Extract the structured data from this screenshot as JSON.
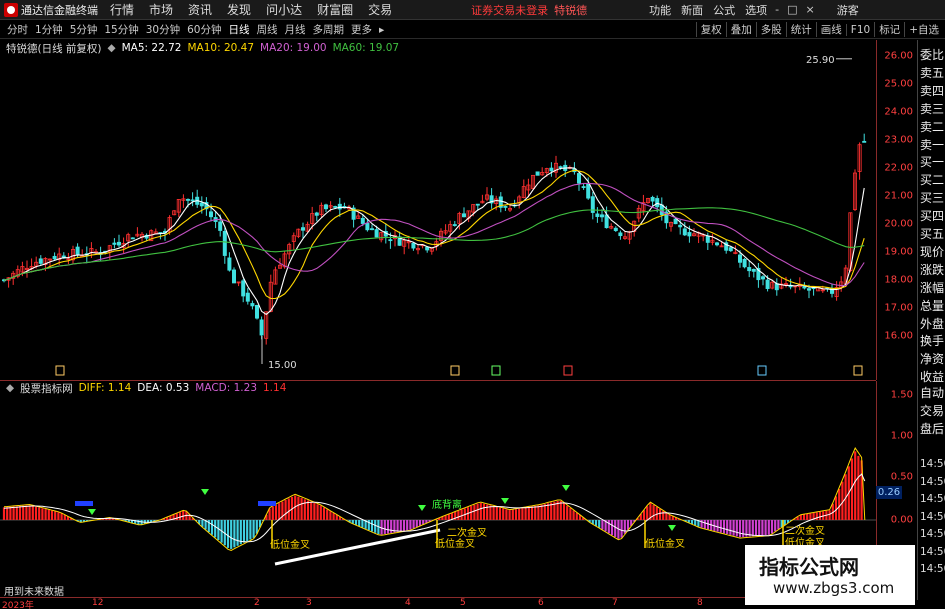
{
  "app": {
    "title": "通达信金融终端"
  },
  "menu": [
    "行情",
    "市场",
    "资讯",
    "发现",
    "问小达",
    "财富圈",
    "交易"
  ],
  "status": {
    "login": "证券交易未登录",
    "stock_name": "特锐德"
  },
  "right_menu": [
    "功能",
    "新面",
    "公式",
    "选项"
  ],
  "guest_label": "游客",
  "window_controls": [
    "-",
    "□",
    "×"
  ],
  "periods": [
    "分时",
    "1分钟",
    "5分钟",
    "15分钟",
    "30分钟",
    "60分钟",
    "日线",
    "周线",
    "月线",
    "多周期",
    "更多"
  ],
  "active_period": "日线",
  "toolbar_right": [
    "复权",
    "叠加",
    "多股",
    "统计",
    "画线",
    "F10",
    "标记",
    "+自选"
  ],
  "chart_header": {
    "stock": "特锐德(日线 前复权)",
    "ma5": "MA5: 22.72",
    "ma10": "MA10: 20.47",
    "ma20": "MA20: 19.00",
    "ma60": "MA60: 19.07"
  },
  "colors": {
    "ma5": "#ffffff",
    "ma10": "#ffd700",
    "ma20": "#c050c0",
    "ma60": "#40c040",
    "up": "#ff3030",
    "down": "#40e0e0",
    "axis": "#ff4040"
  },
  "price_axis": [
    "26.00",
    "25.00",
    "24.00",
    "23.00",
    "22.00",
    "21.00",
    "20.00",
    "19.00",
    "18.00",
    "17.00",
    "16.00"
  ],
  "price_annotations": {
    "high": "25.90",
    "low": "15.00"
  },
  "macd_header": {
    "name": "股票指标网",
    "diff": "DIFF: 1.14",
    "dea": "DEA: 0.53",
    "macd": "MACD: 1.23",
    "extra": "1.14"
  },
  "macd_axis": [
    "1.50",
    "1.00",
    "0.50",
    "0.00"
  ],
  "macd_current": "0.26",
  "macd_labels": [
    "低位金叉",
    "底背离",
    "二次金叉",
    "低位金叉",
    "低位金叉",
    "二次金叉",
    "低位金叉"
  ],
  "side_panel": [
    "委比",
    "卖五",
    "卖四",
    "卖三",
    "卖二",
    "卖一",
    "买一",
    "买二",
    "买三",
    "买四",
    "买五",
    "现价",
    "涨跌",
    "涨幅",
    "总量",
    "外盘",
    "换手",
    "净资",
    "收益",
    "自动",
    "交易",
    "盘后",
    "14:50",
    "14:50",
    "14:50",
    "14:50",
    "14:50",
    "14:50",
    "14:50"
  ],
  "date_axis": [
    "2023年",
    "12",
    "2",
    "3",
    "4",
    "5",
    "6",
    "7",
    "8"
  ],
  "hint": "用到未来数据",
  "watermark": {
    "title": "指标公式网",
    "url": "www.zbgs3.com"
  }
}
